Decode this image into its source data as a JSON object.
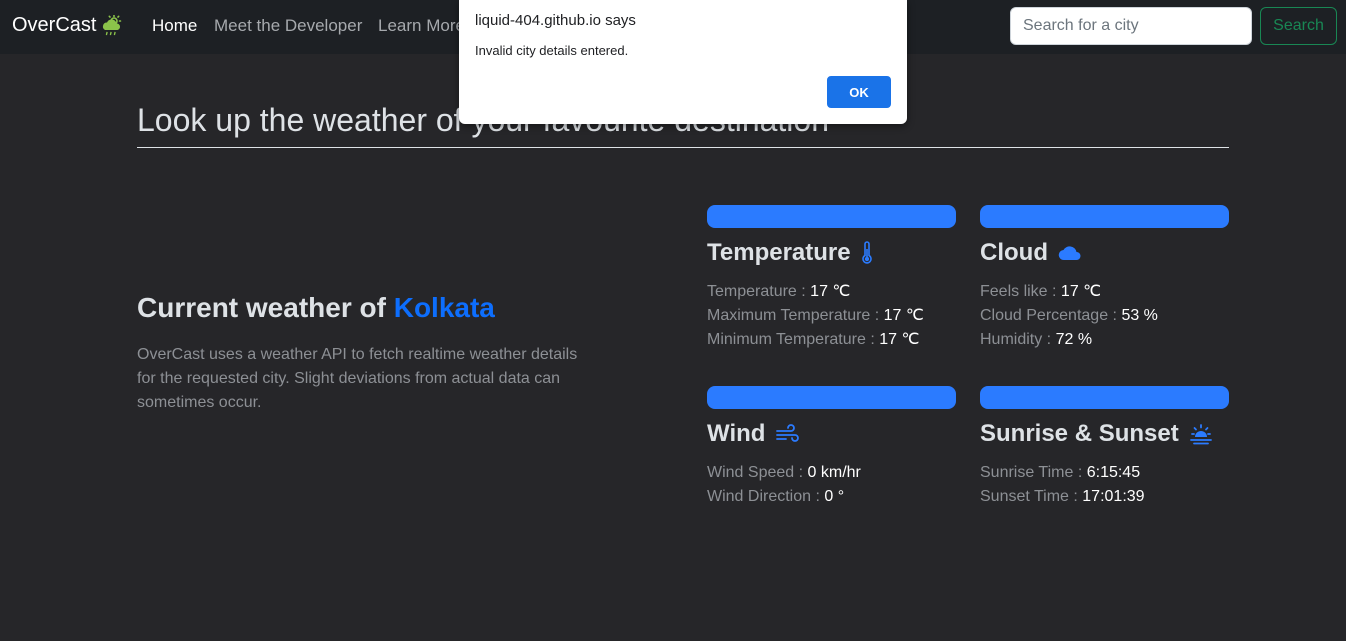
{
  "nav": {
    "brand": "OverCast",
    "links": [
      "Home",
      "Meet the Developer",
      "Learn More"
    ],
    "search_placeholder": "Search for a city",
    "search_button": "Search"
  },
  "headline": "Look up the weather of your favourite destination",
  "current": {
    "prefix": "Current weather of",
    "city": "Kolkata",
    "description": "OverCast uses a weather API to fetch realtime weather details for the requested city. Slight deviations from actual data can sometimes occur."
  },
  "cards": {
    "temperature": {
      "title": "Temperature",
      "rows": [
        {
          "label": "Temperature :",
          "value": "17 ℃"
        },
        {
          "label": "Maximum Temperature :",
          "value": "17 ℃"
        },
        {
          "label": "Minimum Temperature :",
          "value": "17 ℃"
        }
      ]
    },
    "cloud": {
      "title": "Cloud",
      "rows": [
        {
          "label": "Feels like :",
          "value": "17 ℃"
        },
        {
          "label": "Cloud Percentage :",
          "value": "53 %"
        },
        {
          "label": "Humidity :",
          "value": "72 %"
        }
      ]
    },
    "wind": {
      "title": "Wind",
      "rows": [
        {
          "label": "Wind Speed :",
          "value": "0 km/hr"
        },
        {
          "label": "Wind Direction :",
          "value": "0 °"
        }
      ]
    },
    "sun": {
      "title": "Sunrise & Sunset",
      "rows": [
        {
          "label": "Sunrise Time :",
          "value": "6:15:45"
        },
        {
          "label": "Sunset Time :",
          "value": "17:01:39"
        }
      ]
    }
  },
  "dialog": {
    "title": "liquid-404.github.io says",
    "message": "Invalid city details entered.",
    "ok": "OK"
  },
  "colors": {
    "accent": "#0d6efd",
    "card_bar": "#2b7bff",
    "search_outline": "#198754",
    "brand_icon": "#8bc34a"
  },
  "icons": [
    "cloud-sun-rain-icon",
    "thermometer-icon",
    "cloud-icon",
    "wind-icon",
    "sunrise-icon"
  ]
}
